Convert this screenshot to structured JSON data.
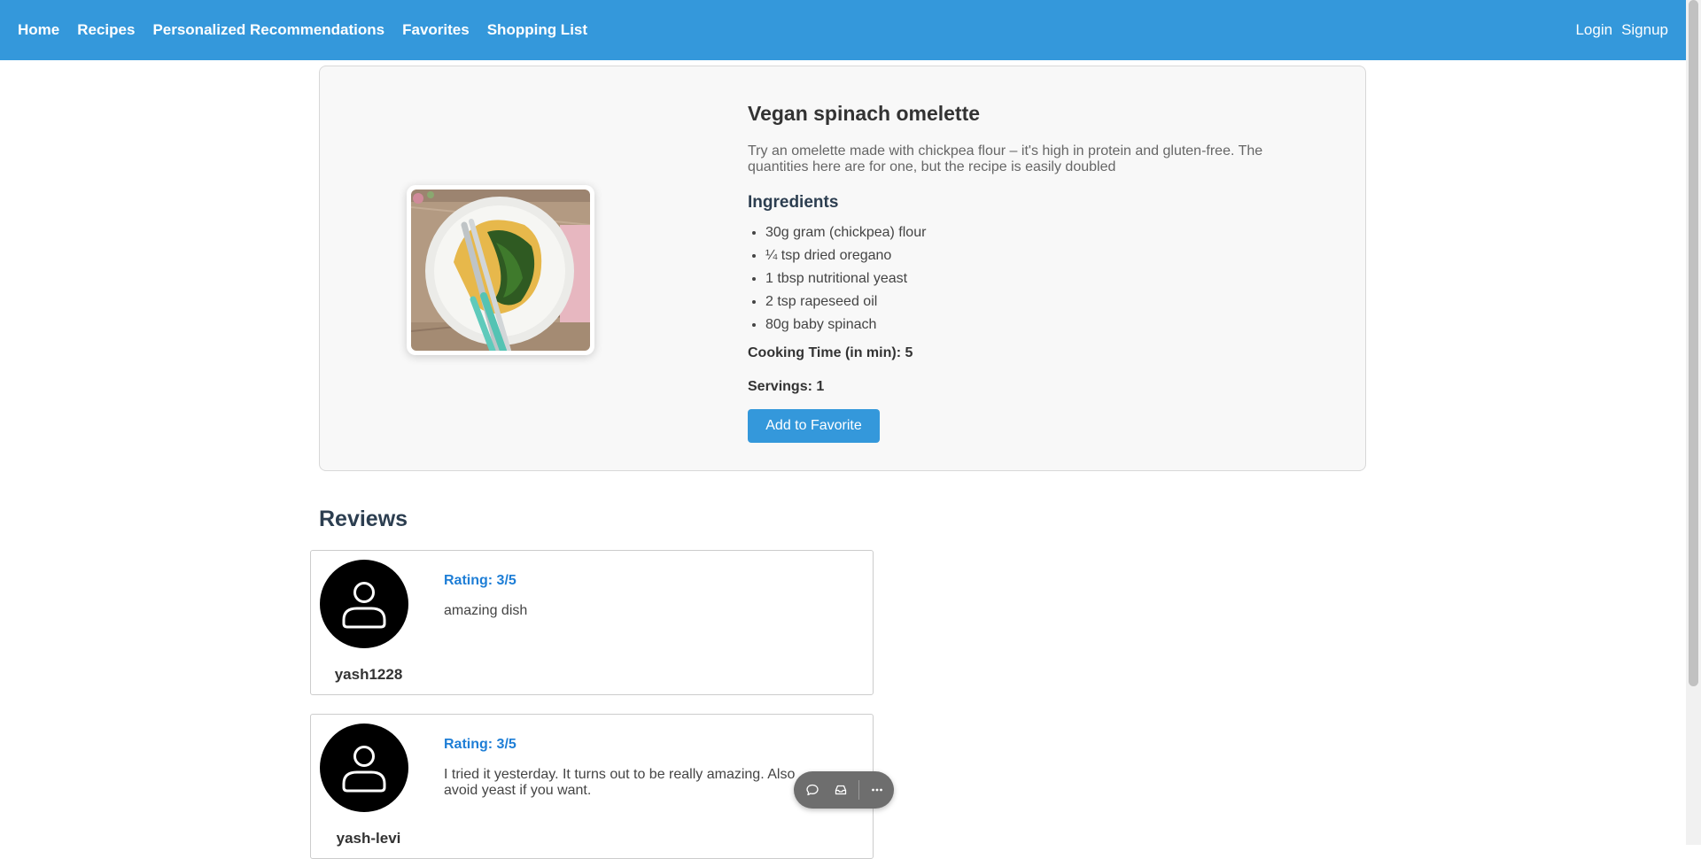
{
  "nav": {
    "left": [
      "Home",
      "Recipes",
      "Personalized Recommendations",
      "Favorites",
      "Shopping List"
    ],
    "login": "Login",
    "signup": "Signup"
  },
  "recipe": {
    "title": "Vegan spinach omelette",
    "description": "Try an omelette made with chickpea flour – it's high in protein and gluten-free. The quantities here are for one, but the recipe is easily doubled",
    "ingredients_heading": "Ingredients",
    "ingredients": [
      "30g gram (chickpea) flour",
      "¼ tsp dried oregano",
      "1 tbsp nutritional yeast",
      "2 tsp rapeseed oil",
      "80g baby spinach"
    ],
    "cooking_time": "Cooking Time (in min): 5",
    "servings": "Servings: 1",
    "favorite_button": "Add to Favorite"
  },
  "reviews": {
    "heading": "Reviews",
    "items": [
      {
        "username": "yash1228",
        "rating": "Rating: 3/5",
        "comment": "amazing dish"
      },
      {
        "username": "yash-levi",
        "rating": "Rating: 3/5",
        "comment": "I tried it yesterday. It turns out to be really amazing. Also avoid yeast if you want."
      }
    ]
  },
  "toolbar_icons": [
    "comment-icon",
    "inbox-icon",
    "more-icon"
  ],
  "colors": {
    "navbar": "#3498db",
    "button": "#3498db",
    "rating": "#1e7ed6",
    "toolbar": "#6e6e6e"
  }
}
